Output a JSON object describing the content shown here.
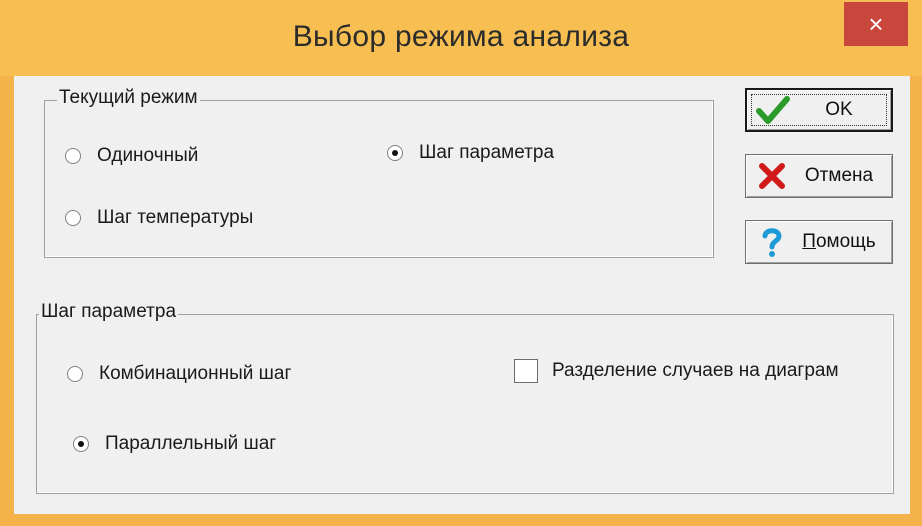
{
  "window": {
    "title": "Выбор режима анализа",
    "close_label": "×"
  },
  "current_mode": {
    "legend": "Текущий режим",
    "options": {
      "single": {
        "label": "Одиночный",
        "checked": false
      },
      "param_step": {
        "label": "Шаг параметра",
        "checked": true
      },
      "temp_step": {
        "label": "Шаг температуры",
        "checked": false
      }
    }
  },
  "param_step_group": {
    "legend": "Шаг параметра",
    "options": {
      "combinational": {
        "label": "Комбинационный шаг",
        "checked": false
      },
      "parallel": {
        "label": "Параллельный шаг",
        "checked": true
      }
    },
    "checkbox": {
      "label": "Разделение случаев на диаграм",
      "checked": false
    }
  },
  "buttons": {
    "ok": {
      "label": "OK",
      "icon": "checkmark-icon",
      "color": "#2a9a2a"
    },
    "cancel": {
      "label": "Отмена",
      "icon": "red-x-icon",
      "color": "#d01a1a"
    },
    "help": {
      "label": "Помощь",
      "icon": "question-icon",
      "color": "#1e9bd6"
    }
  },
  "colors": {
    "frame": "#f4b34a",
    "client": "#f0f0f0",
    "close": "#c9463d"
  }
}
